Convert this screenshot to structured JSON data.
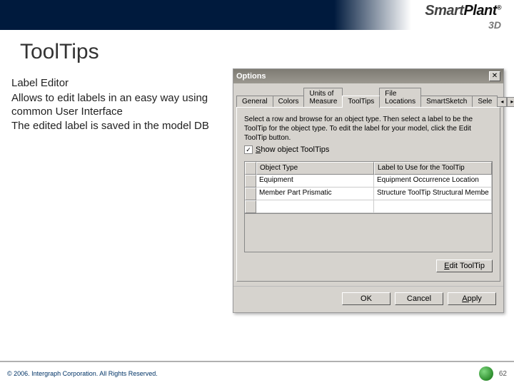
{
  "logo": {
    "line1a": "Smart",
    "line1b": "Plant",
    "reg": "®",
    "line2": "3D"
  },
  "slide": {
    "title": "ToolTips",
    "bullets": [
      "Label Editor",
      "Allows to edit labels in an easy way using common User Interface",
      "The edited label is saved in the model DB"
    ]
  },
  "dialog": {
    "title": "Options",
    "tabs": [
      "General",
      "Colors",
      "Units of Measure",
      "ToolTips",
      "File Locations",
      "SmartSketch",
      "Sele"
    ],
    "activeTab": "ToolTips",
    "instruction": "Select a row and browse for an object type. Then select a label to be the ToolTip for the object type. To edit the label for your model, click the Edit ToolTip button.",
    "checkbox": {
      "checked": true,
      "labelPre": "S",
      "labelRest": "how object ToolTips"
    },
    "gridHeaders": [
      "Object Type",
      "Label to Use for the ToolTip"
    ],
    "gridRows": [
      {
        "c1": "Equipment",
        "c2": "Equipment Occurrence Location"
      },
      {
        "c1": "Member Part Prismatic",
        "c2": "Structure ToolTip Structural Membe"
      }
    ],
    "editBtn": {
      "pre": "E",
      "rest": "dit ToolTip"
    },
    "buttons": {
      "ok": "OK",
      "cancel": "Cancel",
      "applyPre": "A",
      "applyRest": "pply"
    }
  },
  "footer": {
    "copyright": "© 2006. Intergraph Corporation. All Rights Reserved.",
    "pagenum": "62"
  }
}
